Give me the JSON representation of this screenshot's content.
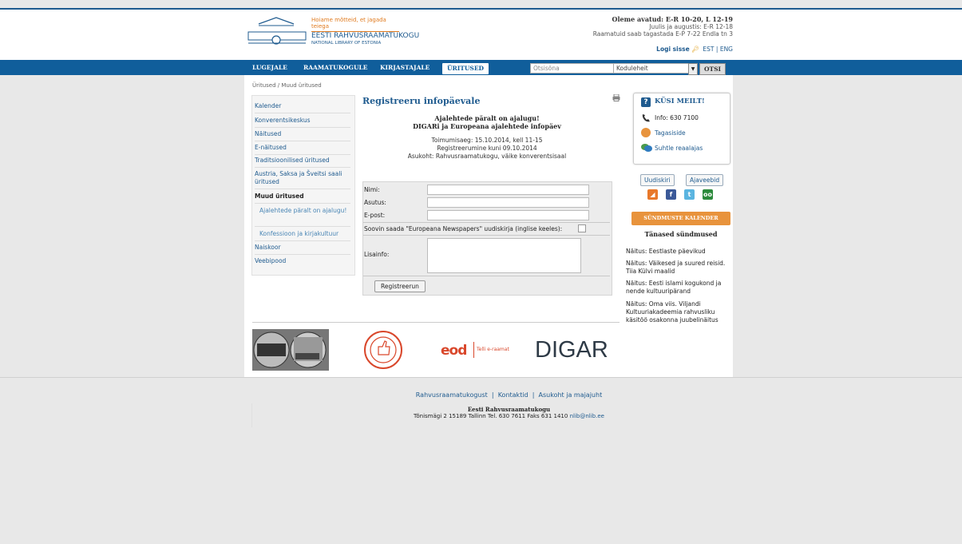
{
  "header": {
    "slogan": "Hoiame mõtteid, et jagada teiega",
    "library_name": "EESTI RAHVUSRAAMATUKOGU",
    "library_name_en": "NATIONAL LIBRARY OF ESTONIA",
    "hours_line1": "Oleme avatud: E-R 10-20, L 12-19",
    "hours_line2": "Juulis ja augustis: E-R 12-18",
    "hours_line3": "Raamatuid saab tagastada E-P 7-22 Endla tn 3",
    "login_label": "Logi sisse",
    "lang_est": "EST",
    "lang_sep": "|",
    "lang_eng": "ENG"
  },
  "nav": {
    "items": [
      "LUGEJALE",
      "RAAMATUKOGULE",
      "KIRJASTAJALE",
      "ÜRITUSED"
    ],
    "search_placeholder": "Otsisõna",
    "scope_selected": "Koduleheit",
    "search_button": "OTSI"
  },
  "breadcrumb": "Üritused / Muud üritused",
  "sidebar": {
    "items": [
      {
        "label": "Kalender"
      },
      {
        "label": "Konverentsikeskus"
      },
      {
        "label": "Näitused"
      },
      {
        "label": "E-näitused"
      },
      {
        "label": "Traditsioonilised üritused"
      },
      {
        "label": "Austria, Saksa ja Šveitsi saali üritused"
      },
      {
        "label": "Muud üritused"
      },
      {
        "label": "Ajalehtede päralt on ajalugu!"
      },
      {
        "label": "Konfessioon ja kirjakultuur"
      },
      {
        "label": "Naiskoor"
      },
      {
        "label": "Veebipood"
      }
    ]
  },
  "main": {
    "title": "Registreeru infopäevale",
    "event_title1": "Ajalehtede päralt on ajalugu!",
    "event_title2": "DIGARi ja Europeana ajalehtede infopäev",
    "time": "Toimumisaeg: 15.10.2014, kell 11-15",
    "deadline": "Registreerumine kuni 09.10.2014",
    "location": "Asukoht: Rahvusraamatukogu, väike konverentsisaal",
    "form": {
      "name_label": "Nimi:",
      "org_label": "Asutus:",
      "email_label": "E-post:",
      "newsletter_label": "Soovin saada \"Europeana Newspapers\" uudiskirja (inglise keeles):",
      "extra_label": "Lisainfo:",
      "submit": "Registreerun"
    },
    "logos": {
      "eod": "eod",
      "eod_sub": "Telli e-raamat",
      "digar": "DIGAR"
    }
  },
  "right": {
    "ask_title": "KÜSI MEILT!",
    "info": "Info: 630 7100",
    "feedback": "Tagasiside",
    "chat": "Suhtle reaalajas",
    "newsletter_tab": "Uudiskiri",
    "blogs_tab": "Ajaveebid",
    "calendar_button": "SÜNDMUSTE KALENDER",
    "today_title": "Tänased sündmused",
    "events": [
      "Näitus: Eestlaste päevikud",
      "Näitus: Väikesed ja suured reisid. Tiia Külvi maalid",
      "Näitus: Eesti islami kogukond ja nende kultuuripärand",
      "Näitus: Oma viis. Viljandi Kultuuriakadeemia rahvusliku käsitöö osakonna juubelinäitus"
    ]
  },
  "footer": {
    "link1": "Rahvusraamatukogust",
    "link2": "Kontaktid",
    "link3": "Asukoht ja majajuht",
    "sep": "|",
    "name": "Eesti Rahvusraamatukogu",
    "address": "Tõnismägi 2 15189 Tallinn Tel. 630 7611 Faks 631 1410",
    "email": "nlib@nlib.ee"
  },
  "colors": {
    "brand_blue": "#105e9b",
    "accent_orange": "#e8933c"
  }
}
